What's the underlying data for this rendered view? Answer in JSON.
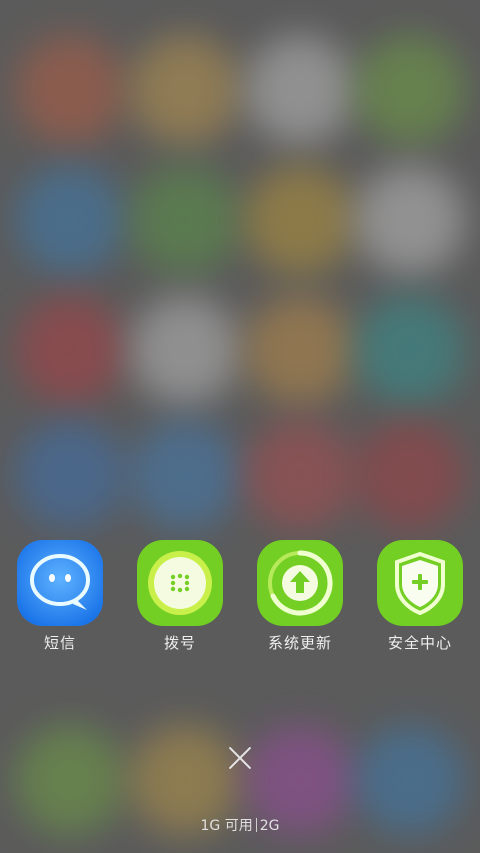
{
  "background": {
    "description_colors": [
      "#e2623a",
      "#f0b84a",
      "#f2f2f2",
      "#7cc63a",
      "#2f8fe0",
      "#5bb33f",
      "#e7b52a",
      "#f5f5f5",
      "#d9323a",
      "#f0f0f0",
      "#f0a840",
      "#20b2b0",
      "#2f7fe0",
      "#3790e6",
      "#d9464b",
      "#c9323a",
      "#7cc63a",
      "#e8b840",
      "#c044c8",
      "#2e8fe0"
    ]
  },
  "dock": {
    "apps": [
      {
        "label": "短信",
        "icon": "message-icon",
        "color": "#2f8cf5"
      },
      {
        "label": "拨号",
        "icon": "dialpad-icon",
        "color": "#78d22a"
      },
      {
        "label": "系统更新",
        "icon": "update-icon",
        "color": "#78d22a"
      },
      {
        "label": "安全中心",
        "icon": "shield-icon",
        "color": "#78d22a"
      }
    ]
  },
  "footer": {
    "memory_left": "1G 可用",
    "memory_right": "2G"
  }
}
